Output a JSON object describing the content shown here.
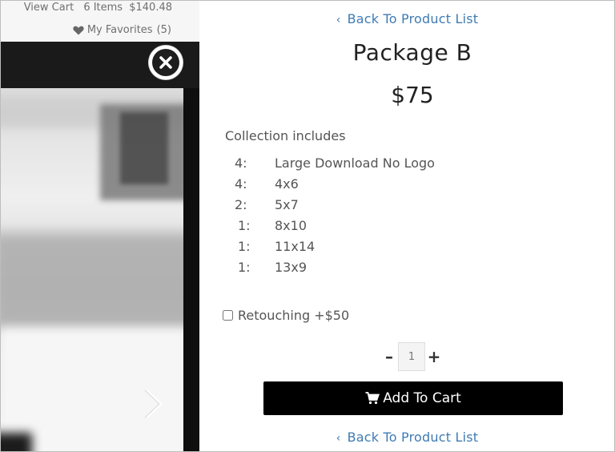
{
  "header": {
    "view_cart": "View Cart",
    "cart_count": "6 Items",
    "cart_total": "$140.48",
    "favorites_label": "My Favorites",
    "favorites_count": "(5)"
  },
  "icons": {
    "favorites": "heart-icon",
    "close": "close-icon",
    "next": "chevron-right-icon",
    "back": "chevron-left-icon",
    "cart": "cart-icon"
  },
  "product": {
    "back_link": "Back To Product List",
    "title": "Package B",
    "price": "$75",
    "includes_heading": "Collection includes",
    "items": [
      {
        "qty": "4:",
        "name": "Large Download No Logo"
      },
      {
        "qty": "4:",
        "name": "4x6"
      },
      {
        "qty": "2:",
        "name": "5x7"
      },
      {
        "qty": "1:",
        "name": "8x10"
      },
      {
        "qty": "1:",
        "name": "11x14"
      },
      {
        "qty": "1:",
        "name": "13x9"
      }
    ],
    "option_label": "Retouching +$50",
    "option_checked": false,
    "quantity": "1",
    "decrement": "–",
    "increment": "+",
    "add_to_cart": "Add To Cart"
  },
  "colors": {
    "link": "#3f7bb3",
    "button_bg": "#000000",
    "button_text": "#ffffff"
  }
}
